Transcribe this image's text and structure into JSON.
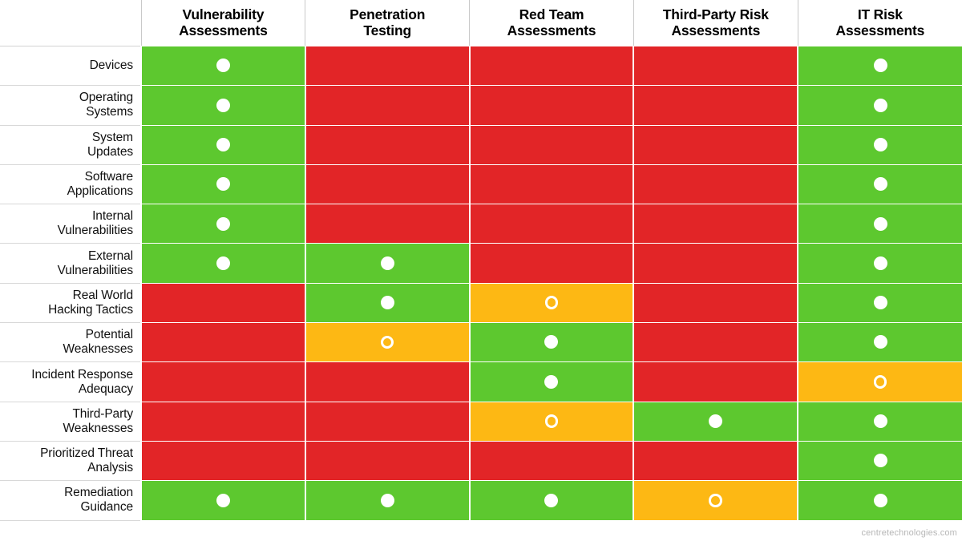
{
  "matrix": {
    "corner_label": "",
    "columns": [
      "Vulnerability Assessments",
      "Penetration Testing",
      "Red Team Assessments",
      "Third-Party Risk Assessments",
      "IT Risk Assessments"
    ],
    "column_lines": [
      [
        "Vulnerability",
        "Assessments"
      ],
      [
        "Penetration",
        "Testing"
      ],
      [
        "Red Team",
        "Assessments"
      ],
      [
        "Third-Party Risk",
        "Assessments"
      ],
      [
        "IT Risk",
        "Assessments"
      ]
    ],
    "rows": [
      {
        "label": "Devices",
        "label_lines": [
          "Devices"
        ],
        "cells": [
          {
            "status": "green",
            "marker": "filled"
          },
          {
            "status": "red",
            "marker": "none"
          },
          {
            "status": "red",
            "marker": "none"
          },
          {
            "status": "red",
            "marker": "none"
          },
          {
            "status": "green",
            "marker": "filled"
          }
        ]
      },
      {
        "label": "Operating Systems",
        "label_lines": [
          "Operating",
          "Systems"
        ],
        "cells": [
          {
            "status": "green",
            "marker": "filled"
          },
          {
            "status": "red",
            "marker": "none"
          },
          {
            "status": "red",
            "marker": "none"
          },
          {
            "status": "red",
            "marker": "none"
          },
          {
            "status": "green",
            "marker": "filled"
          }
        ]
      },
      {
        "label": "System Updates",
        "label_lines": [
          "System",
          "Updates"
        ],
        "cells": [
          {
            "status": "green",
            "marker": "filled"
          },
          {
            "status": "red",
            "marker": "none"
          },
          {
            "status": "red",
            "marker": "none"
          },
          {
            "status": "red",
            "marker": "none"
          },
          {
            "status": "green",
            "marker": "filled"
          }
        ]
      },
      {
        "label": "Software Applications",
        "label_lines": [
          "Software",
          "Applications"
        ],
        "cells": [
          {
            "status": "green",
            "marker": "filled"
          },
          {
            "status": "red",
            "marker": "none"
          },
          {
            "status": "red",
            "marker": "none"
          },
          {
            "status": "red",
            "marker": "none"
          },
          {
            "status": "green",
            "marker": "filled"
          }
        ]
      },
      {
        "label": "Internal Vulnerabilities",
        "label_lines": [
          "Internal",
          "Vulnerabilities"
        ],
        "cells": [
          {
            "status": "green",
            "marker": "filled"
          },
          {
            "status": "red",
            "marker": "none"
          },
          {
            "status": "red",
            "marker": "none"
          },
          {
            "status": "red",
            "marker": "none"
          },
          {
            "status": "green",
            "marker": "filled"
          }
        ]
      },
      {
        "label": "External Vulnerabilities",
        "label_lines": [
          "External",
          "Vulnerabilities"
        ],
        "cells": [
          {
            "status": "green",
            "marker": "filled"
          },
          {
            "status": "green",
            "marker": "filled"
          },
          {
            "status": "red",
            "marker": "none"
          },
          {
            "status": "red",
            "marker": "none"
          },
          {
            "status": "green",
            "marker": "filled"
          }
        ]
      },
      {
        "label": "Real World Hacking Tactics",
        "label_lines": [
          "Real World",
          "Hacking Tactics"
        ],
        "cells": [
          {
            "status": "red",
            "marker": "none"
          },
          {
            "status": "green",
            "marker": "filled"
          },
          {
            "status": "orange",
            "marker": "ring"
          },
          {
            "status": "red",
            "marker": "none"
          },
          {
            "status": "green",
            "marker": "filled"
          }
        ]
      },
      {
        "label": "Potential Weaknesses",
        "label_lines": [
          "Potential",
          "Weaknesses"
        ],
        "cells": [
          {
            "status": "red",
            "marker": "none"
          },
          {
            "status": "orange",
            "marker": "ring"
          },
          {
            "status": "green",
            "marker": "filled"
          },
          {
            "status": "red",
            "marker": "none"
          },
          {
            "status": "green",
            "marker": "filled"
          }
        ]
      },
      {
        "label": "Incident Response Adequacy",
        "label_lines": [
          "Incident Response",
          "Adequacy"
        ],
        "cells": [
          {
            "status": "red",
            "marker": "none"
          },
          {
            "status": "red",
            "marker": "none"
          },
          {
            "status": "green",
            "marker": "filled"
          },
          {
            "status": "red",
            "marker": "none"
          },
          {
            "status": "orange",
            "marker": "ring"
          }
        ]
      },
      {
        "label": "Third-Party Weaknesses",
        "label_lines": [
          "Third-Party",
          "Weaknesses"
        ],
        "cells": [
          {
            "status": "red",
            "marker": "none"
          },
          {
            "status": "red",
            "marker": "none"
          },
          {
            "status": "orange",
            "marker": "ring"
          },
          {
            "status": "green",
            "marker": "filled"
          },
          {
            "status": "green",
            "marker": "filled"
          }
        ]
      },
      {
        "label": "Prioritized Threat Analysis",
        "label_lines": [
          "Prioritized Threat",
          "Analysis"
        ],
        "cells": [
          {
            "status": "red",
            "marker": "none"
          },
          {
            "status": "red",
            "marker": "none"
          },
          {
            "status": "red",
            "marker": "none"
          },
          {
            "status": "red",
            "marker": "none"
          },
          {
            "status": "green",
            "marker": "filled"
          }
        ]
      },
      {
        "label": "Remediation Guidance",
        "label_lines": [
          "Remediation",
          "Guidance"
        ],
        "cells": [
          {
            "status": "green",
            "marker": "filled"
          },
          {
            "status": "green",
            "marker": "filled"
          },
          {
            "status": "green",
            "marker": "filled"
          },
          {
            "status": "orange",
            "marker": "ring"
          },
          {
            "status": "green",
            "marker": "filled"
          }
        ]
      }
    ]
  },
  "colors": {
    "green": "#5DC82F",
    "red": "#E22527",
    "orange": "#FDB814",
    "marker": "#FFFFFF",
    "watermark_text": "#B6B6B6"
  },
  "watermark": {
    "text": "centretechnologies.com"
  }
}
